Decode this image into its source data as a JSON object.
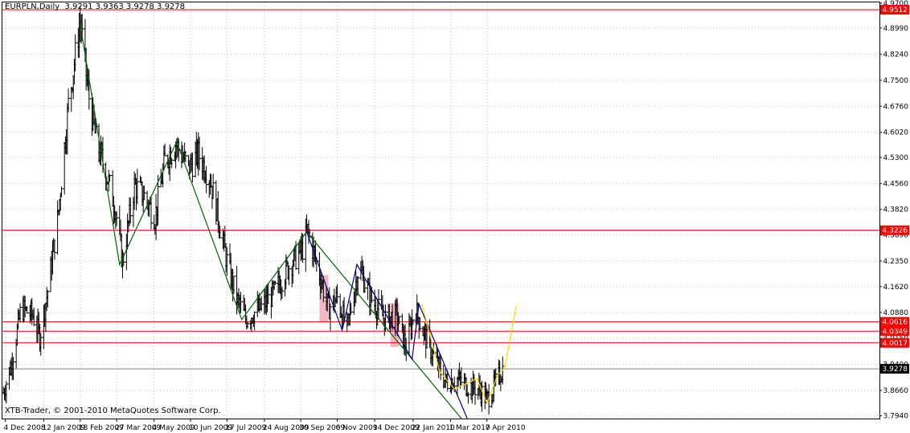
{
  "header": {
    "symbol": "EURPLN,Daily",
    "ohlc": "3.9291 3.9363 3.9278 3.9278"
  },
  "footer": {
    "copyright": "XTB-Trader, © 2001-2010 MetaQuotes Software Corp."
  },
  "colors": {
    "background": "#ffffff",
    "grid": "#c0c0c0",
    "bars": "#000000",
    "level_line": "#ff0000",
    "level_box": "#ff0000",
    "current_price_box": "#000000",
    "current_price_line": "#808080",
    "zigzag_green": "#006400",
    "zigzag_navy": "#000080",
    "projection": "#ffd700",
    "highlight": "#f0a0b0"
  },
  "chart_data": {
    "type": "ohlc",
    "title": "EURPLN,Daily",
    "ylim": [
      3.786,
      4.972
    ],
    "y_ticks": [
      "4.9700",
      "4.8990",
      "4.8240",
      "4.7500",
      "4.6760",
      "4.6020",
      "4.5300",
      "4.4560",
      "4.3820",
      "4.3090",
      "4.2350",
      "4.1620",
      "4.0880",
      "4.0150",
      "3.9400",
      "3.8660",
      "3.7940"
    ],
    "x_tick_labels": [
      "4 Dec 2008",
      "12 Jan 2009",
      "18 Feb 2009",
      "27 Mar 2009",
      "4 May 2009",
      "10 Jun 2009",
      "17 Jul 2009",
      "24 Aug 2009",
      "30 Sep 2009",
      "6 Nov 2009",
      "14 Dec 2009",
      "22 Jan 2010",
      "1 Mar 2010",
      "7 Apr 2010"
    ],
    "grid": true,
    "current_price": 3.9278,
    "current_price_label": "3.9278",
    "horizontal_levels": [
      {
        "value": 4.9512,
        "label": "4.9512"
      },
      {
        "value": 4.3226,
        "label": "4.3226"
      },
      {
        "value": 4.0616,
        "label": "4.0616"
      },
      {
        "value": 4.0349,
        "label": "4.0349"
      },
      {
        "value": 4.0017,
        "label": "4.0017"
      }
    ],
    "close_series": [
      {
        "date": "2008-12-02",
        "close": 3.86
      },
      {
        "date": "2008-12-10",
        "close": 3.94
      },
      {
        "date": "2008-12-20",
        "close": 4.1
      },
      {
        "date": "2009-01-01",
        "close": 4.08
      },
      {
        "date": "2009-01-08",
        "close": 4.02
      },
      {
        "date": "2009-01-16",
        "close": 4.15
      },
      {
        "date": "2009-01-26",
        "close": 4.35
      },
      {
        "date": "2009-02-06",
        "close": 4.68
      },
      {
        "date": "2009-02-18",
        "close": 4.92
      },
      {
        "date": "2009-02-26",
        "close": 4.72
      },
      {
        "date": "2009-03-06",
        "close": 4.58
      },
      {
        "date": "2009-03-17",
        "close": 4.48
      },
      {
        "date": "2009-03-26",
        "close": 4.38
      },
      {
        "date": "2009-04-02",
        "close": 4.23
      },
      {
        "date": "2009-04-14",
        "close": 4.45
      },
      {
        "date": "2009-04-24",
        "close": 4.42
      },
      {
        "date": "2009-05-05",
        "close": 4.36
      },
      {
        "date": "2009-05-15",
        "close": 4.52
      },
      {
        "date": "2009-05-26",
        "close": 4.57
      },
      {
        "date": "2009-06-08",
        "close": 4.5
      },
      {
        "date": "2009-06-18",
        "close": 4.54
      },
      {
        "date": "2009-06-30",
        "close": 4.47
      },
      {
        "date": "2009-07-08",
        "close": 4.36
      },
      {
        "date": "2009-07-18",
        "close": 4.22
      },
      {
        "date": "2009-07-28",
        "close": 4.12
      },
      {
        "date": "2009-08-05",
        "close": 4.07
      },
      {
        "date": "2009-08-20",
        "close": 4.1
      },
      {
        "date": "2009-09-02",
        "close": 4.14
      },
      {
        "date": "2009-09-18",
        "close": 4.22
      },
      {
        "date": "2009-10-02",
        "close": 4.27
      },
      {
        "date": "2009-10-07",
        "close": 4.32
      },
      {
        "date": "2009-10-17",
        "close": 4.22
      },
      {
        "date": "2009-10-28",
        "close": 4.1
      },
      {
        "date": "2009-11-06",
        "close": 4.13
      },
      {
        "date": "2009-11-16",
        "close": 4.04
      },
      {
        "date": "2009-11-28",
        "close": 4.22
      },
      {
        "date": "2009-12-10",
        "close": 4.13
      },
      {
        "date": "2009-12-24",
        "close": 4.07
      },
      {
        "date": "2010-01-05",
        "close": 4.08
      },
      {
        "date": "2010-01-15",
        "close": 3.99
      },
      {
        "date": "2010-01-24",
        "close": 4.1
      },
      {
        "date": "2010-02-03",
        "close": 4.02
      },
      {
        "date": "2010-02-14",
        "close": 3.95
      },
      {
        "date": "2010-02-24",
        "close": 3.89
      },
      {
        "date": "2010-03-07",
        "close": 3.9
      },
      {
        "date": "2010-03-18",
        "close": 3.88
      },
      {
        "date": "2010-03-30",
        "close": 3.87
      },
      {
        "date": "2010-04-07",
        "close": 3.84
      },
      {
        "date": "2010-04-15",
        "close": 3.88
      },
      {
        "date": "2010-04-23",
        "close": 3.9278
      }
    ],
    "zigzag_green": [
      {
        "date": "2009-02-17",
        "value": 4.925
      },
      {
        "date": "2009-03-30",
        "value": 4.225
      },
      {
        "date": "2009-05-27",
        "value": 4.575
      },
      {
        "date": "2009-08-01",
        "value": 4.068
      },
      {
        "date": "2009-10-06",
        "value": 4.318
      },
      {
        "date": "2010-03-12",
        "value": 3.786
      }
    ],
    "zigzag_navy": [
      {
        "date": "2009-10-06",
        "value": 4.318
      },
      {
        "date": "2009-11-11",
        "value": 4.038
      },
      {
        "date": "2009-11-26",
        "value": 4.225
      },
      {
        "date": "2010-01-21",
        "value": 3.955
      },
      {
        "date": "2010-01-28",
        "value": 4.112
      },
      {
        "date": "2010-03-18",
        "value": 3.786
      }
    ],
    "projection_yellow": [
      {
        "date": "2010-01-31",
        "value": 4.112
      },
      {
        "date": "2010-02-18",
        "value": 3.92
      },
      {
        "date": "2010-03-05",
        "value": 3.87
      },
      {
        "date": "2010-03-28",
        "value": 3.9
      },
      {
        "date": "2010-04-07",
        "value": 3.83
      },
      {
        "date": "2010-04-18",
        "value": 3.91
      },
      {
        "date": "2010-04-25",
        "value": 3.93
      },
      {
        "date": "2010-05-07",
        "value": 4.11
      }
    ],
    "highlight_zones": [
      {
        "start": "2009-10-19",
        "end": "2009-10-28",
        "high": 4.195,
        "low": 4.06
      },
      {
        "start": "2009-12-30",
        "end": "2010-01-08",
        "high": 4.115,
        "low": 3.99
      }
    ]
  }
}
